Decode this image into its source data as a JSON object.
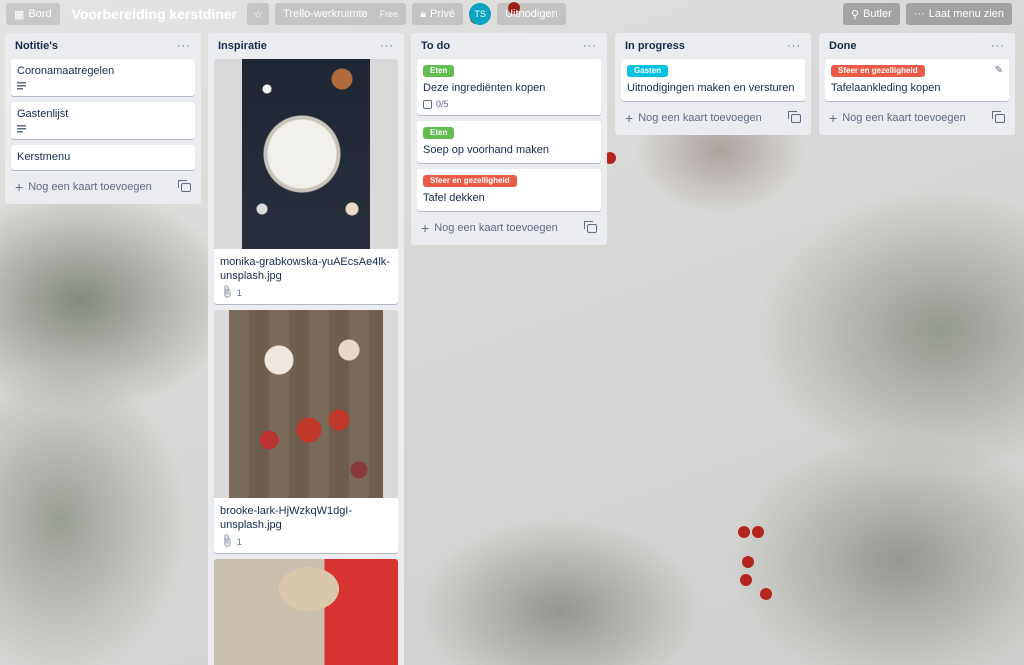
{
  "header": {
    "board_button": "Bord",
    "board_title": "Voorbereiding kerstdiner",
    "team": "Trello-werkruimte",
    "team_plan": "Free",
    "visibility": "Privé",
    "avatar_initials": "TS",
    "invite": "Uitnodigen",
    "butler": "Butler",
    "show_menu": "Laat menu zien"
  },
  "add_card_label": "Nog een kaart toevoegen",
  "lists": [
    {
      "title": "Notitie's",
      "cards": [
        {
          "title": "Coronamaatregelen",
          "has_description": true
        },
        {
          "title": "Gastenlijst",
          "has_description": true
        },
        {
          "title": "Kerstmenu"
        }
      ]
    },
    {
      "title": "Inspiratie",
      "cards": [
        {
          "title": "monika-grabkowska-yuAEcsAe4lk-unsplash.jpg",
          "attachments": "1"
        },
        {
          "title": "brooke-lark-HjWzkqW1dgI-unsplash.jpg",
          "attachments": "1"
        }
      ]
    },
    {
      "title": "To do",
      "cards": [
        {
          "label": "Eten",
          "title": "Deze ingrediënten kopen",
          "checklist": "0/5"
        },
        {
          "label": "Eten",
          "title": "Soep op voorhand maken"
        },
        {
          "label": "Sfeer en gezelligheid",
          "title": "Tafel dekken"
        }
      ]
    },
    {
      "title": "In progress",
      "cards": [
        {
          "label": "Gasten",
          "title": "Uitnodigingen maken en versturen"
        }
      ]
    },
    {
      "title": "Done",
      "cards": [
        {
          "label": "Sfeer en gezelligheid",
          "title": "Tafelaankleding kopen"
        }
      ]
    }
  ],
  "colors": {
    "label_eten": "#61bd4f",
    "label_sfeer": "#eb5a46",
    "label_gasten": "#00c2e0",
    "list_bg": "#ebecf0"
  },
  "icons": [
    "star-icon",
    "lock-icon",
    "plus-icon",
    "template-icon",
    "description-icon",
    "checklist-icon",
    "attachment-icon",
    "pencil-icon",
    "butler-icon",
    "dots-icon"
  ]
}
